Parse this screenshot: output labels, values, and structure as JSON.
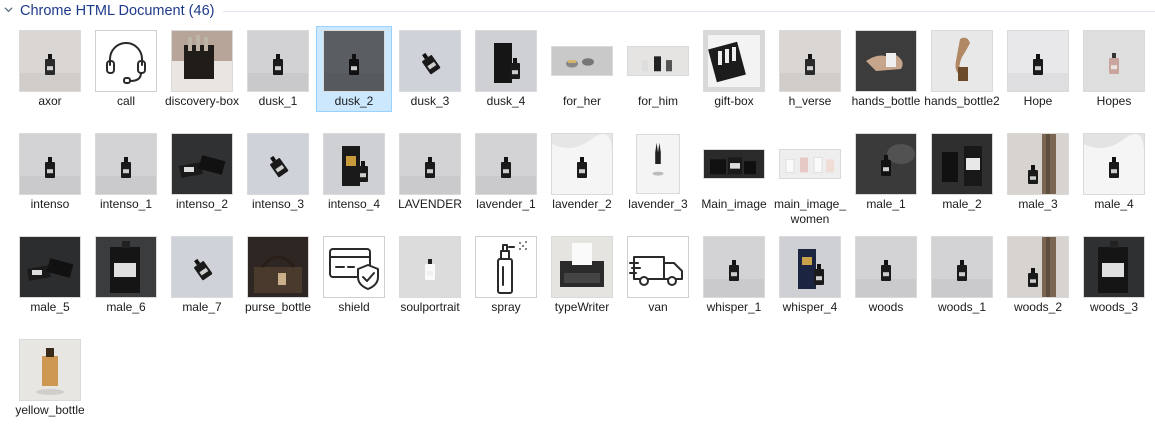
{
  "group": {
    "title": "Chrome HTML Document (46)",
    "chevron": "chevron-down-icon"
  },
  "files": [
    {
      "name": "axor",
      "bg": "#d9d6d3",
      "style": "photo-bottle",
      "accent": "#2a2a2a",
      "icon": "image-thumbnail"
    },
    {
      "name": "call",
      "bg": "#ffffff",
      "style": "icon-headset",
      "accent": "#1a1a1a",
      "icon": "headset-icon"
    },
    {
      "name": "discovery-box",
      "bg": "#b8a59a",
      "style": "photo-box",
      "accent": "#3a3330",
      "icon": "image-thumbnail"
    },
    {
      "name": "dusk_1",
      "bg": "#d2d2d4",
      "style": "photo-bottle",
      "accent": "#1a1a1a",
      "icon": "image-thumbnail"
    },
    {
      "name": "dusk_2",
      "bg": "#5a5d62",
      "style": "photo-bottle",
      "accent": "#101010",
      "icon": "image-thumbnail",
      "selected": true
    },
    {
      "name": "dusk_3",
      "bg": "#cfd3d9",
      "style": "photo-tilted",
      "accent": "#1a1a1a",
      "icon": "image-thumbnail"
    },
    {
      "name": "dusk_4",
      "bg": "#cfd0d4",
      "style": "photo-boxbottle",
      "accent": "#151515",
      "icon": "image-thumbnail"
    },
    {
      "name": "for_her",
      "bg": "#c9c9c9",
      "style": "photo-wide",
      "accent": "#555555",
      "icon": "image-thumbnail"
    },
    {
      "name": "for_him",
      "bg": "#e6e4e2",
      "style": "photo-wide-trio",
      "accent": "#333333",
      "icon": "image-thumbnail"
    },
    {
      "name": "gift-box",
      "bg": "#d8d8d8",
      "style": "photo-giftbox",
      "accent": "#2a2a2a",
      "icon": "image-thumbnail"
    },
    {
      "name": "h_verse",
      "bg": "#d9d6d3",
      "style": "photo-bottle",
      "accent": "#2a2a2a",
      "icon": "image-thumbnail"
    },
    {
      "name": "hands_bottle",
      "bg": "#3c3c3c",
      "style": "photo-hands",
      "accent": "#e0e0e0",
      "icon": "image-thumbnail"
    },
    {
      "name": "hands_bottle2",
      "bg": "#e8e8e8",
      "style": "photo-hand-light",
      "accent": "#6b4b2a",
      "icon": "image-thumbnail"
    },
    {
      "name": "Hope",
      "bg": "#e8e8ea",
      "style": "photo-bottle",
      "accent": "#1a1a1a",
      "icon": "image-thumbnail"
    },
    {
      "name": "Hopes",
      "bg": "#dedede",
      "style": "photo-bottle-pink",
      "accent": "#555555",
      "icon": "image-thumbnail"
    },
    {
      "name": "intenso",
      "bg": "#d3d3d5",
      "style": "photo-bottle",
      "accent": "#1a1a1a",
      "icon": "image-thumbnail"
    },
    {
      "name": "intenso_1",
      "bg": "#d3d3d5",
      "style": "photo-bottle",
      "accent": "#1a1a1a",
      "icon": "image-thumbnail"
    },
    {
      "name": "intenso_2",
      "bg": "#2f3133",
      "style": "photo-dark-lying",
      "accent": "#111111",
      "icon": "image-thumbnail"
    },
    {
      "name": "intenso_3",
      "bg": "#cfd3d9",
      "style": "photo-tilted",
      "accent": "#1a1a1a",
      "icon": "image-thumbnail"
    },
    {
      "name": "intenso_4",
      "bg": "#cfd0d4",
      "style": "photo-boxbottle-gold",
      "accent": "#151515",
      "icon": "image-thumbnail"
    },
    {
      "name": "LAVENDER",
      "bg": "#d3d3d5",
      "style": "photo-bottle",
      "accent": "#1a1a1a",
      "icon": "image-thumbnail"
    },
    {
      "name": "lavender_1",
      "bg": "#d3d3d5",
      "style": "photo-bottle",
      "accent": "#1a1a1a",
      "icon": "image-thumbnail"
    },
    {
      "name": "lavender_2",
      "bg": "#e6e6e6",
      "style": "photo-fabric",
      "accent": "#1a1a1a",
      "icon": "image-thumbnail"
    },
    {
      "name": "lavender_3",
      "bg": "#f4f4f4",
      "style": "photo-tall-bunny",
      "accent": "#222222",
      "icon": "image-thumbnail"
    },
    {
      "name": "Main_image",
      "bg": "#2a2a2a",
      "style": "photo-wide-dark",
      "accent": "#e8e8e8",
      "icon": "image-thumbnail"
    },
    {
      "name": "main_image_women",
      "bg": "#eeeeee",
      "style": "photo-wide-quad",
      "accent": "#333333",
      "icon": "image-thumbnail"
    },
    {
      "name": "male_1",
      "bg": "#3a3a3a",
      "style": "photo-bottle-dark",
      "accent": "#111111",
      "icon": "image-thumbnail"
    },
    {
      "name": "male_2",
      "bg": "#2f2f2f",
      "style": "photo-dark-duo",
      "accent": "#e8e8e8",
      "icon": "image-thumbnail"
    },
    {
      "name": "male_3",
      "bg": "#d7d3cf",
      "style": "photo-wood",
      "accent": "#6b5a48",
      "icon": "image-thumbnail"
    },
    {
      "name": "male_4",
      "bg": "#e3e3e3",
      "style": "photo-fabric",
      "accent": "#1a1a1a",
      "icon": "image-thumbnail"
    },
    {
      "name": "male_5",
      "bg": "#2b2d2f",
      "style": "photo-dark-lying",
      "accent": "#111111",
      "icon": "image-thumbnail"
    },
    {
      "name": "male_6",
      "bg": "#3a3c3e",
      "style": "photo-dark-big",
      "accent": "#d0d0d0",
      "icon": "image-thumbnail"
    },
    {
      "name": "male_7",
      "bg": "#cfd3d9",
      "style": "photo-tilted",
      "accent": "#1a1a1a",
      "icon": "image-thumbnail"
    },
    {
      "name": "purse_bottle",
      "bg": "#2e2622",
      "style": "photo-purse",
      "accent": "#8a6a4a",
      "icon": "image-thumbnail"
    },
    {
      "name": "shield",
      "bg": "#ffffff",
      "style": "icon-shield",
      "accent": "#2a2a2a",
      "icon": "card-shield-icon"
    },
    {
      "name": "soulportrait",
      "bg": "#dcdcdc",
      "style": "photo-bottle-white",
      "accent": "#ffffff",
      "icon": "image-thumbnail"
    },
    {
      "name": "spray",
      "bg": "#ffffff",
      "style": "icon-spray",
      "accent": "#2a2a2a",
      "icon": "spray-icon"
    },
    {
      "name": "typeWriter",
      "bg": "#e6e4e0",
      "style": "photo-typewriter",
      "accent": "#2a2a2a",
      "icon": "image-thumbnail"
    },
    {
      "name": "van",
      "bg": "#ffffff",
      "style": "icon-van",
      "accent": "#2a2a2a",
      "icon": "van-icon"
    },
    {
      "name": "whisper_1",
      "bg": "#d3d3d5",
      "style": "photo-bottle",
      "accent": "#1a1a1a",
      "icon": "image-thumbnail"
    },
    {
      "name": "whisper_4",
      "bg": "#cfd0d4",
      "style": "photo-boxbottle-blue",
      "accent": "#151515",
      "icon": "image-thumbnail"
    },
    {
      "name": "woods",
      "bg": "#d3d3d5",
      "style": "photo-bottle",
      "accent": "#1a1a1a",
      "icon": "image-thumbnail"
    },
    {
      "name": "woods_1",
      "bg": "#d3d3d5",
      "style": "photo-bottle",
      "accent": "#1a1a1a",
      "icon": "image-thumbnail"
    },
    {
      "name": "woods_2",
      "bg": "#d7d3cf",
      "style": "photo-wood",
      "accent": "#6b5a48",
      "icon": "image-thumbnail"
    },
    {
      "name": "woods_3",
      "bg": "#2e3032",
      "style": "photo-dark-big",
      "accent": "#d0d0d0",
      "icon": "image-thumbnail"
    },
    {
      "name": "yellow_bottle",
      "bg": "#e8e6e3",
      "style": "photo-yellow",
      "accent": "#c98a3a",
      "icon": "image-thumbnail"
    }
  ]
}
